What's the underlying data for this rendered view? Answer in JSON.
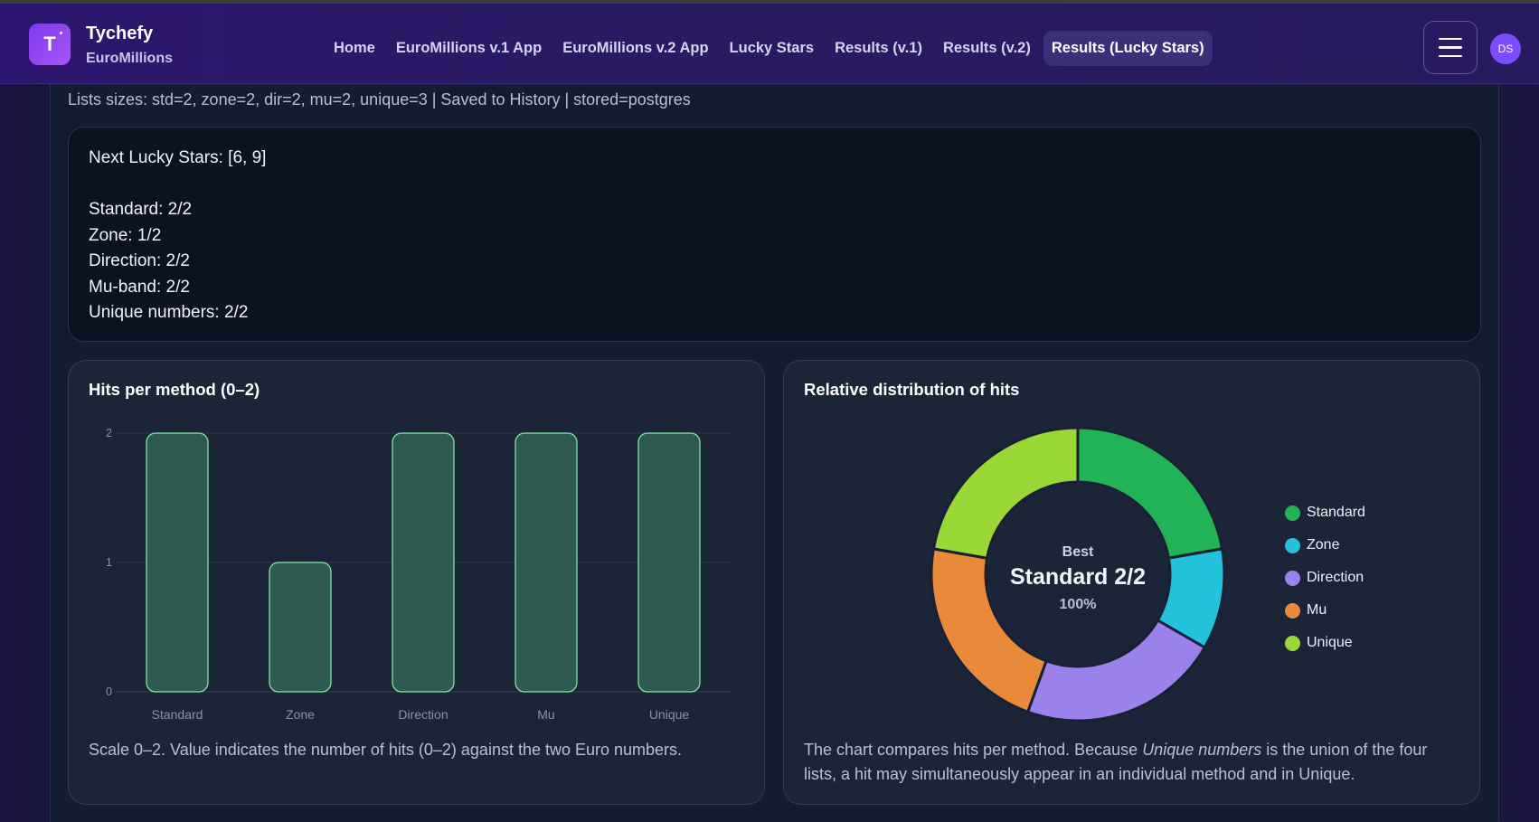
{
  "app": {
    "brand_name": "Tychefy",
    "brand_sub": "EuroMillions",
    "logo_letter": "T",
    "avatar_initials": "DS"
  },
  "nav": {
    "items": [
      {
        "label": "Home",
        "active": false
      },
      {
        "label": "EuroMillions v.1 App",
        "active": false
      },
      {
        "label": "EuroMillions v.2 App",
        "active": false
      },
      {
        "label": "Lucky Stars",
        "active": false
      },
      {
        "label": "Results (v.1)",
        "active": false
      },
      {
        "label": "Results (v.2)",
        "active": false
      },
      {
        "label": "Results (Lucky Stars)",
        "active": true
      }
    ]
  },
  "main": {
    "sizes_line": "Lists sizes: std=2, zone=2, dir=2, mu=2, unique=3 | Saved to History | stored=postgres",
    "result_lines": {
      "next": "Next Lucky Stars: [6, 9]",
      "standard": "Standard: 2/2",
      "zone": "Zone: 1/2",
      "direction": "Direction: 2/2",
      "mu_band": "Mu-band: 2/2",
      "unique": "Unique numbers: 2/2"
    }
  },
  "bar_panel": {
    "title": "Hits per method (0–2)",
    "footnote": "Scale 0–2. Value indicates the number of hits (0–2) against the two Euro numbers."
  },
  "donut_panel": {
    "title": "Relative distribution of hits",
    "center_label": "Best",
    "center_value": "Standard 2/2",
    "center_percent": "100%",
    "footnote_before": "The chart compares hits per method. Because ",
    "footnote_em": "Unique numbers",
    "footnote_after": " is the union of the four lists, a hit may simultaneously appear in an individual method and in Unique."
  },
  "colors": {
    "bar_fill": "#2f5a52",
    "bar_stroke": "#86efac",
    "standard": "#22b357",
    "zone": "#22c2dc",
    "direction": "#9b82ea",
    "mu": "#e98a3a",
    "unique": "#9ad935"
  },
  "chart_data": [
    {
      "type": "bar",
      "title": "Hits per method (0–2)",
      "categories": [
        "Standard",
        "Zone",
        "Direction",
        "Mu",
        "Unique"
      ],
      "values": [
        2,
        1,
        2,
        2,
        2
      ],
      "ylim": [
        0,
        2
      ],
      "yticks": [
        0,
        1,
        2
      ],
      "grid": true
    },
    {
      "type": "pie",
      "title": "Relative distribution of hits",
      "labels": [
        "Standard",
        "Zone",
        "Direction",
        "Mu",
        "Unique"
      ],
      "values": [
        2,
        1,
        2,
        2,
        2
      ],
      "legend": "right",
      "colors": [
        "#22b357",
        "#22c2dc",
        "#9b82ea",
        "#e98a3a",
        "#9ad935"
      ]
    }
  ]
}
